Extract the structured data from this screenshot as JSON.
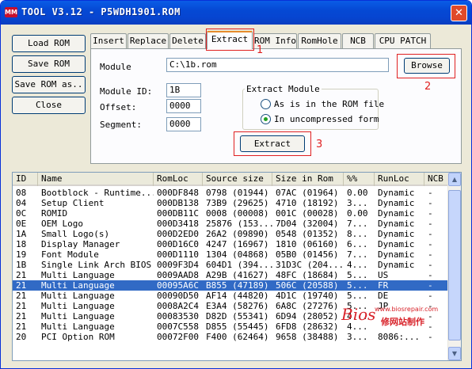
{
  "window": {
    "title": "TOOL V3.12 - P5WDH1901.ROM",
    "close_glyph": "✕"
  },
  "left_buttons": {
    "load": "Load ROM",
    "save": "Save ROM",
    "save_as": "Save ROM as..",
    "close": "Close"
  },
  "tabs": [
    "Insert",
    "Replace",
    "Delete",
    "Extract",
    "ROM Info",
    "RomHole",
    "NCB",
    "CPU PATCH"
  ],
  "active_tab": "Extract",
  "extract": {
    "module_label": "Module",
    "module_value": "C:\\1b.rom",
    "browse": "Browse",
    "module_id_label": "Module ID:",
    "module_id_value": "1B",
    "offset_label": "Offset:",
    "offset_value": "0000",
    "segment_label": "Segment:",
    "segment_value": "0000",
    "group_title": "Extract Module",
    "radio_as_is": "As is in the ROM file",
    "radio_uncompressed": "In uncompressed form",
    "selected_radio": "uncompressed",
    "extract_button": "Extract"
  },
  "annotations": {
    "n1": "1",
    "n2": "2",
    "n3": "3",
    "color": "#e02020"
  },
  "table": {
    "columns": [
      "ID",
      "Name",
      "RomLoc",
      "Source size",
      "Size in Rom",
      "%%",
      "RunLoc",
      "NCB"
    ],
    "selected_index": 9,
    "rows": [
      [
        "08",
        "Bootblock - Runtime...",
        "000DF848",
        "0798 (01944)",
        "07AC (01964)",
        "0.00",
        "Dynamic",
        "-"
      ],
      [
        "04",
        "Setup Client",
        "000DB138",
        "73B9 (29625)",
        "4710 (18192)",
        "3...",
        "Dynamic",
        "-"
      ],
      [
        "0C",
        "ROMID",
        "000DB11C",
        "0008 (00008)",
        "001C (00028)",
        "0.00",
        "Dynamic",
        "-"
      ],
      [
        "0E",
        "OEM Logo",
        "000D3418",
        "25876 (153...",
        "7D04 (32004)",
        "7...",
        "Dynamic",
        "-"
      ],
      [
        "1A",
        "Small Logo(s)",
        "000D2ED0",
        "26A2 (09890)",
        "0548 (01352)",
        "8...",
        "Dynamic",
        "-"
      ],
      [
        "18",
        "Display Manager",
        "000D16C0",
        "4247 (16967)",
        "1810 (06160)",
        "6...",
        "Dynamic",
        "-"
      ],
      [
        "19",
        "Font Module",
        "000D1110",
        "1304 (04868)",
        "05B0 (01456)",
        "7...",
        "Dynamic",
        "-"
      ],
      [
        "1B",
        "Single Link Arch BIOS",
        "0009F3D4",
        "604D1 (394...",
        "31D3C (204...",
        "4...",
        "Dynamic",
        "-"
      ],
      [
        "21",
        "Multi Language",
        "0009AAD8",
        "A29B (41627)",
        "48FC (18684)",
        "5...",
        "US",
        "-"
      ],
      [
        "21",
        "Multi Language",
        "00095A6C",
        "B855 (47189)",
        "506C (20588)",
        "5...",
        "FR",
        "-"
      ],
      [
        "21",
        "Multi Language",
        "00090D50",
        "AF14 (44820)",
        "4D1C (19740)",
        "5...",
        "DE",
        "-"
      ],
      [
        "21",
        "Multi Language",
        "0008A2C4",
        "E3A4 (58276)",
        "6A8C (27276)",
        "5...",
        "JP",
        "-"
      ],
      [
        "21",
        "Multi Language",
        "00083530",
        "D82D (55341)",
        "6D94 (28052)",
        "4...",
        "",
        "-"
      ],
      [
        "21",
        "Multi Language",
        "0007C558",
        "D855 (55445)",
        "6FD8 (28632)",
        "4...",
        "",
        "-"
      ],
      [
        "20",
        "PCI Option ROM",
        "00072F00",
        "F400 (62464)",
        "9658 (38488)",
        "3...",
        "8086:...",
        "-"
      ]
    ]
  },
  "watermark": {
    "site": "www.biosrepair.com",
    "logo": "Bios",
    "cn": "修网站制作"
  }
}
